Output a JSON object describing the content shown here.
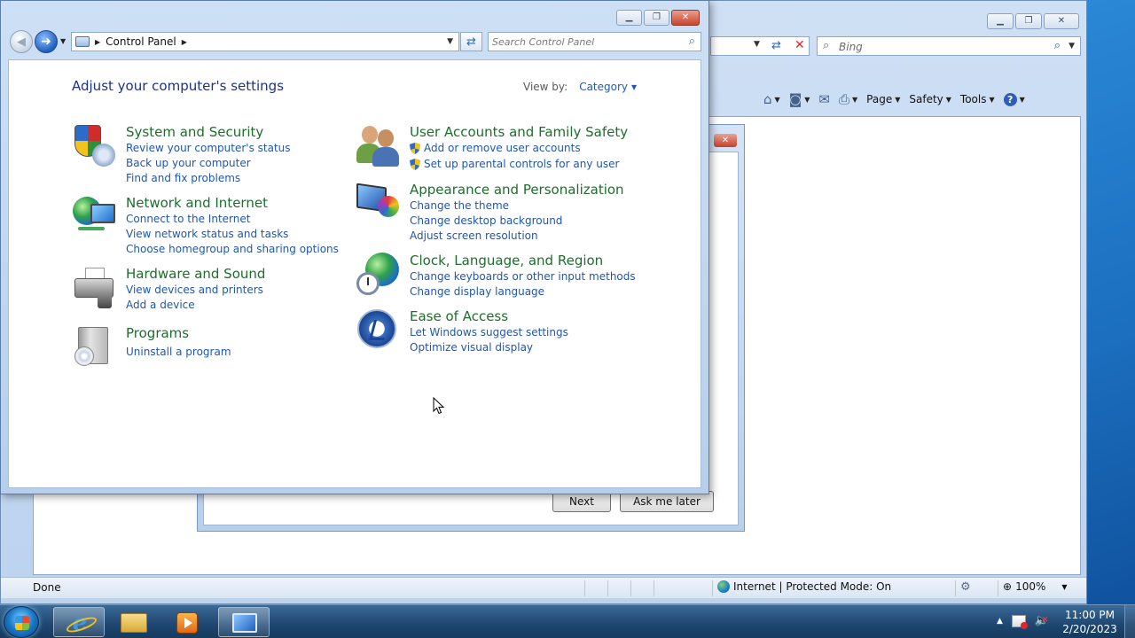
{
  "ie": {
    "search_placeholder": "Bing",
    "commands": {
      "page": "Page",
      "safety": "Safety",
      "tools": "Tools"
    },
    "dialog": {
      "next_label": "Next",
      "later_label": "Ask me later"
    },
    "status": {
      "text": "Done",
      "zone": "Internet | Protected Mode: On",
      "zoom": "100%"
    }
  },
  "control_panel": {
    "breadcrumb": [
      "Control Panel"
    ],
    "search_placeholder": "Search Control Panel",
    "heading": "Adjust your computer's settings",
    "view_by_label": "View by:",
    "view_by_value": "Category",
    "categories": [
      {
        "title": "System and Security",
        "icon": "security-shield-icon",
        "links": [
          "Review your computer's status",
          "Back up your computer",
          "Find and fix problems"
        ]
      },
      {
        "title": "Network and Internet",
        "icon": "network-globe-icon",
        "links": [
          "Connect to the Internet",
          "View network status and tasks",
          "Choose homegroup and sharing options"
        ]
      },
      {
        "title": "Hardware and Sound",
        "icon": "printer-speaker-icon",
        "links": [
          "View devices and printers",
          "Add a device"
        ]
      },
      {
        "title": "Programs",
        "icon": "programs-disc-icon",
        "links": [
          "Uninstall a program"
        ]
      },
      {
        "title": "User Accounts and Family Safety",
        "icon": "users-icon",
        "links": [
          "Add or remove user accounts",
          "Set up parental controls for any user"
        ]
      },
      {
        "title": "Appearance and Personalization",
        "icon": "monitor-palette-icon",
        "links": [
          "Change the theme",
          "Change desktop background",
          "Adjust screen resolution"
        ]
      },
      {
        "title": "Clock, Language, and Region",
        "icon": "clock-globe-icon",
        "links": [
          "Change keyboards or other input methods",
          "Change display language"
        ]
      },
      {
        "title": "Ease of Access",
        "icon": "ease-of-access-icon",
        "links": [
          "Let Windows suggest settings",
          "Optimize visual display"
        ]
      }
    ]
  },
  "taskbar": {
    "time": "11:00 PM",
    "date": "2/20/2023"
  },
  "colors": {
    "category_title": "#1d6e2c",
    "link": "#1f56b0",
    "heading": "#1e3287"
  }
}
